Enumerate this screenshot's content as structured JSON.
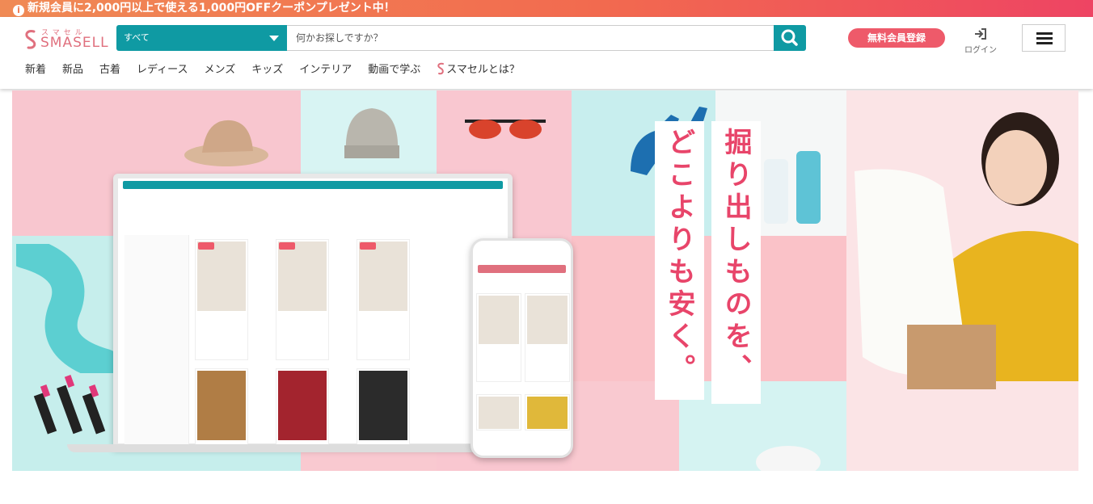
{
  "promo": {
    "text": "新規会員に2,000円以上で使える1,000円OFFクーポンプレゼント中！",
    "icon": "info-icon"
  },
  "logo": {
    "kana": "スマセル",
    "text": "SMASELL"
  },
  "search": {
    "category": "すべて",
    "placeholder": "何かお探しですか？",
    "button_icon": "search-icon"
  },
  "header": {
    "register": "無料会員登録",
    "login": "ログイン",
    "menu_icon": "hamburger-icon"
  },
  "nav": {
    "items": [
      "新着",
      "新品",
      "古着",
      "レディース",
      "メンズ",
      "キッズ",
      "インテリア",
      "動画で学ぶ",
      "スマセルとは？"
    ]
  },
  "hero": {
    "copy_line1": "掘り出しものを、",
    "copy_line2": "どこよりも安く。"
  },
  "colors": {
    "accent": "#0f9aa3",
    "brand_pink": "#ee5a6a",
    "promo_start": "#f08a55",
    "promo_end": "#ee4463",
    "hero_text": "#e8456a"
  }
}
